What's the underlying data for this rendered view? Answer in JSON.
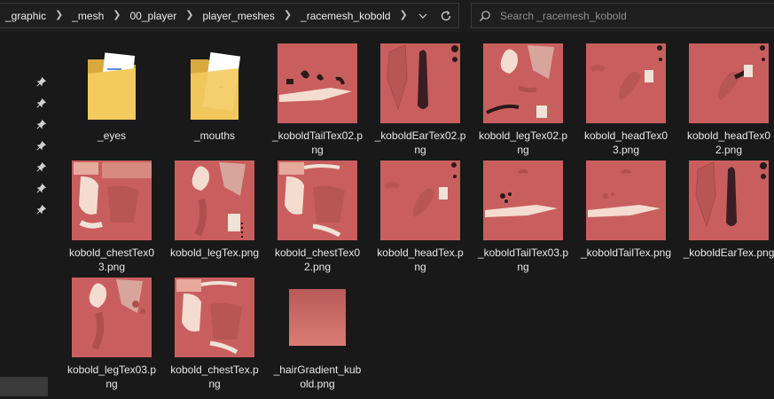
{
  "address_bar": {
    "crumbs": [
      "_graphic",
      "_mesh",
      "00_player",
      "player_meshes",
      "_racemesh_kobold"
    ]
  },
  "search": {
    "placeholder": "Search _racemesh_kobold"
  },
  "colors": {
    "background": "#191919",
    "texture_base": "#c85f5e",
    "folder": "#f0c85a"
  },
  "files": [
    {
      "name": "_eyes",
      "kind": "folder"
    },
    {
      "name": "_mouths",
      "kind": "folder"
    },
    {
      "name": "_koboldTailTex02.png",
      "kind": "texture"
    },
    {
      "name": "_koboldEarTex02.png",
      "kind": "texture"
    },
    {
      "name": "kobold_legTex02.png",
      "kind": "texture"
    },
    {
      "name": "kobold_headTex03.png",
      "kind": "texture"
    },
    {
      "name": "kobold_headTex02.png",
      "kind": "texture"
    },
    {
      "name": "kobold_chestTex03.png",
      "kind": "texture"
    },
    {
      "name": "kobold_legTex.png",
      "kind": "texture"
    },
    {
      "name": "kobold_chestTex02.png",
      "kind": "texture"
    },
    {
      "name": "kobold_headTex.png",
      "kind": "texture"
    },
    {
      "name": "_koboldTailTex03.png",
      "kind": "texture"
    },
    {
      "name": "_koboldTailTex.png",
      "kind": "texture"
    },
    {
      "name": "_koboldEarTex.png",
      "kind": "texture"
    },
    {
      "name": "kobold_legTex03.png",
      "kind": "texture"
    },
    {
      "name": "kobold_chestTex.png",
      "kind": "texture"
    },
    {
      "name": "_hairGradient_kubold.png",
      "kind": "gradient"
    }
  ]
}
